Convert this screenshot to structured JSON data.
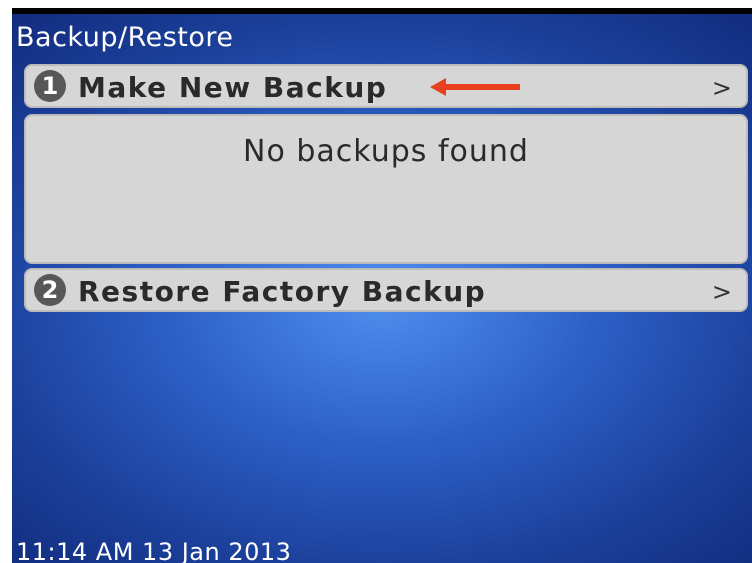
{
  "screen": {
    "title": "Backup/Restore",
    "menu": [
      {
        "number": "1",
        "label": "Make New Backup",
        "chevron": ">"
      },
      {
        "number": "2",
        "label": "Restore Factory Backup",
        "chevron": ">"
      }
    ],
    "info_text": "No backups found",
    "status_time": "11:14 AM 13 Jan 2013"
  },
  "colors": {
    "annotation_arrow": "#e8401e",
    "item_background": "#d6d6d6",
    "badge": "#585858",
    "screen_blue": "#2c5fc6"
  }
}
